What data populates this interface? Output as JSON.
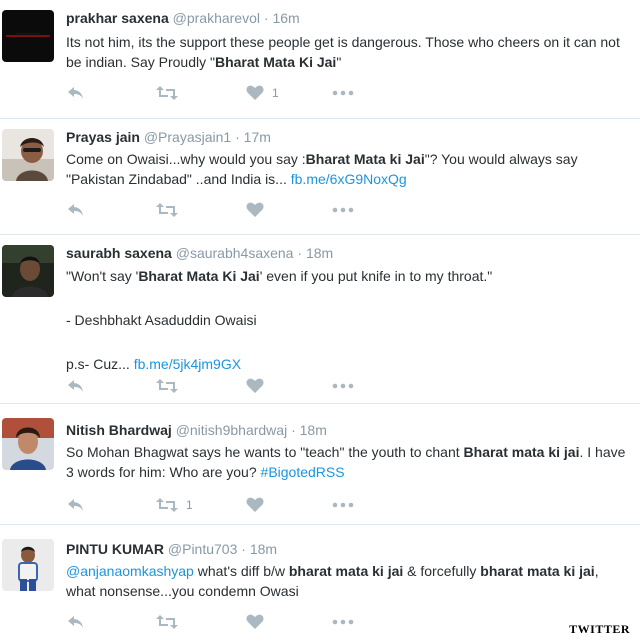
{
  "tweets": [
    {
      "name": "prakhar saxena",
      "handle": "@prakharevol",
      "time": "16m",
      "lines": [
        {
          "parts": [
            {
              "t": "Its not him, its the support these people get is dangerous. Those who cheers on it can not be indian. Say Proudly \"",
              "s": "text"
            },
            {
              "t": "Bharat Mata Ki Jai",
              "s": "bold"
            },
            {
              "t": "\"",
              "s": "text"
            }
          ]
        }
      ],
      "reply_count": "",
      "retweet_count": "",
      "like_count": "1"
    },
    {
      "name": "Prayas jain",
      "handle": "@Prayasjain1",
      "time": "17m",
      "lines": [
        {
          "parts": [
            {
              "t": "Come on Owaisi...why would you say :",
              "s": "text"
            },
            {
              "t": "Bharat Mata ki Jai",
              "s": "bold"
            },
            {
              "t": "\"? You would always say \"Pakistan Zindabad\" ..and India is... ",
              "s": "text"
            },
            {
              "t": "fb.me/6xG9NoxQg",
              "s": "link"
            }
          ]
        }
      ],
      "reply_count": "",
      "retweet_count": "",
      "like_count": ""
    },
    {
      "name": "saurabh saxena",
      "handle": "@saurabh4saxena",
      "time": "18m",
      "lines": [
        {
          "parts": [
            {
              "t": "\"Won't say '",
              "s": "text"
            },
            {
              "t": "Bharat Mata Ki Jai",
              "s": "bold"
            },
            {
              "t": "' even if you put knife in to my throat.\"",
              "s": "text"
            }
          ]
        },
        {
          "parts": [
            {
              "t": "",
              "s": "text"
            }
          ]
        },
        {
          "parts": [
            {
              "t": "- Deshbhakt Asaduddin Owaisi",
              "s": "text"
            }
          ]
        },
        {
          "parts": [
            {
              "t": "",
              "s": "text"
            }
          ]
        },
        {
          "parts": [
            {
              "t": "p.s- Cuz... ",
              "s": "text"
            },
            {
              "t": "fb.me/5jk4jm9GX",
              "s": "link"
            }
          ]
        }
      ],
      "reply_count": "",
      "retweet_count": "",
      "like_count": ""
    },
    {
      "name": "Nitish Bhardwaj",
      "handle": "@nitish9bhardwaj",
      "time": "18m",
      "lines": [
        {
          "parts": [
            {
              "t": "So Mohan Bhagwat says he wants to \"teach\" the youth to chant ",
              "s": "text"
            },
            {
              "t": "Bharat mata ki jai",
              "s": "bold"
            },
            {
              "t": ". I have 3 words for him: Who are you? ",
              "s": "text"
            },
            {
              "t": "#BigotedRSS",
              "s": "link"
            }
          ]
        }
      ],
      "reply_count": "",
      "retweet_count": "1",
      "like_count": ""
    },
    {
      "name": "PINTU KUMAR",
      "handle": "@Pintu703",
      "time": "18m",
      "lines": [
        {
          "parts": [
            {
              "t": "@anjanaomkashyap",
              "s": "link"
            },
            {
              "t": " what's diff b/w ",
              "s": "text"
            },
            {
              "t": "bharat mata ki jai",
              "s": "bold"
            },
            {
              "t": " & forcefully ",
              "s": "text"
            },
            {
              "t": "bharat mata ki jai",
              "s": "bold"
            },
            {
              "t": ", what nonsense...you condemn Owasi",
              "s": "text"
            }
          ]
        }
      ],
      "reply_count": "",
      "retweet_count": "",
      "like_count": ""
    }
  ],
  "separator": " · ",
  "icons": {
    "reply": "reply-arrow-icon",
    "retweet": "retweet-icon",
    "like": "heart-icon",
    "more": "more-dots-icon"
  },
  "colors": {
    "icon": "#aab8c2",
    "link": "#1b95e0",
    "meta": "#8899a6",
    "divider": "#e1e8ed"
  },
  "footer": {
    "credit": "TWITTER"
  }
}
